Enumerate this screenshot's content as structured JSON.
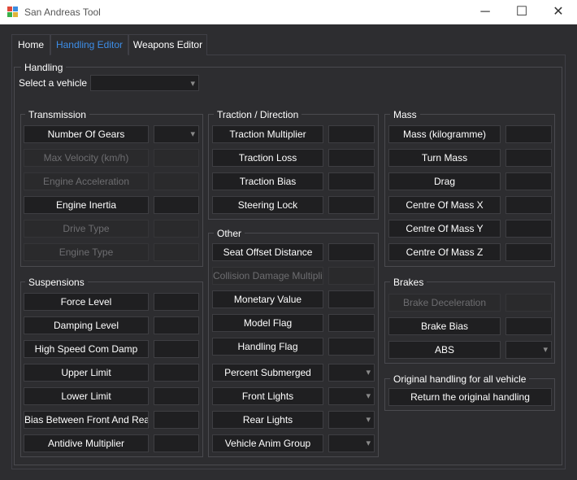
{
  "window": {
    "title": "San Andreas Tool",
    "min": "─",
    "max": "☐",
    "close": "✕"
  },
  "tabs": [
    "Home",
    "Handling Editor",
    "Weapons Editor"
  ],
  "handling": {
    "group": "Handling",
    "select_label": "Select a vehicle :",
    "select_value": ""
  },
  "transmission": {
    "title": "Transmission",
    "items": [
      "Number Of Gears",
      "Max Velocity (km/h)",
      "Engine Acceleration",
      "Engine Inertia",
      "Drive Type",
      "Engine Type"
    ]
  },
  "suspensions": {
    "title": "Suspensions",
    "items": [
      "Force Level",
      "Damping Level",
      "High Speed Com Damp",
      "Upper Limit",
      "Lower Limit",
      "Bias Between Front And Rear",
      "Antidive Multiplier"
    ]
  },
  "traction": {
    "title": "Traction / Direction",
    "items": [
      "Traction Multiplier",
      "Traction Loss",
      "Traction Bias",
      "Steering Lock"
    ]
  },
  "other": {
    "title": "Other",
    "items": [
      "Seat Offset Distance",
      "Collision Damage Multiplier",
      "Monetary Value",
      "Model Flag",
      "Handling Flag",
      "Percent Submerged",
      "Front Lights",
      "Rear Lights",
      "Vehicle Anim Group"
    ]
  },
  "mass": {
    "title": "Mass",
    "items": [
      "Mass (kilogramme)",
      "Turn Mass",
      "Drag",
      "Centre Of Mass X",
      "Centre Of Mass Y",
      "Centre Of Mass Z"
    ]
  },
  "brakes": {
    "title": "Brakes",
    "items": [
      "Brake Deceleration",
      "Brake Bias",
      "ABS"
    ]
  },
  "original": {
    "title": "Original handling for all vehicle",
    "button": "Return the original handling"
  }
}
